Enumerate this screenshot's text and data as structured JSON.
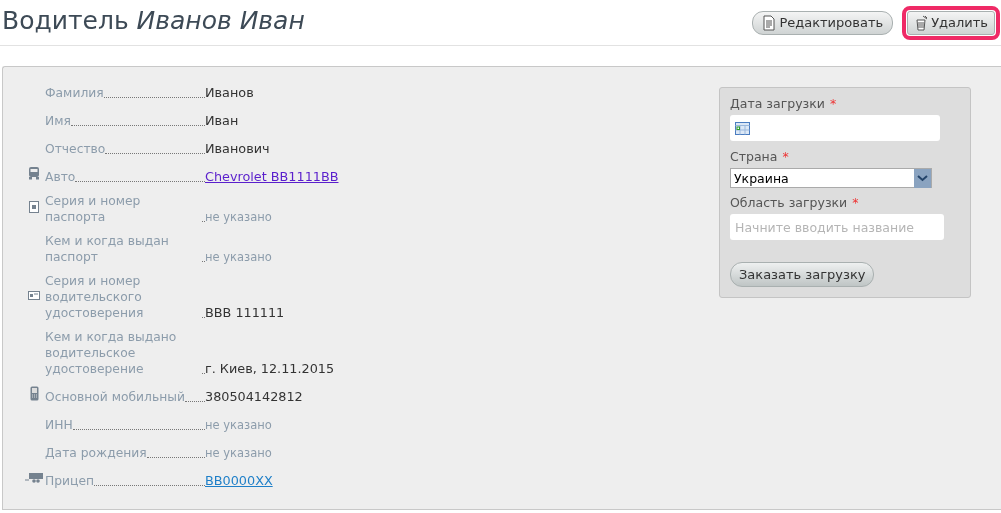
{
  "header": {
    "title": "Водитель *Иванов Иван*",
    "buttons": [
      {
        "label": "Редактировать",
        "highlighted": false
      },
      {
        "label": "Удалить",
        "highlighted": true
      }
    ]
  },
  "details": [
    {
      "label": "Фамилия",
      "value": "Иванов",
      "kind": "text"
    },
    {
      "label": "Имя",
      "value": "Иван",
      "kind": "text"
    },
    {
      "label": "Отчество",
      "value": "Иванович",
      "kind": "text"
    },
    {
      "label": "Авто",
      "value": "Chevrolet BB1111BB",
      "kind": "link",
      "visited": true
    },
    {
      "label": "Серия и номер паспорта",
      "value": "не указано",
      "kind": "missing"
    },
    {
      "label": "Кем и когда выдан паспорт",
      "value": "не указано",
      "kind": "missing"
    },
    {
      "label": "Серия и номер водительского удостоверения",
      "value": "BBB 111111",
      "kind": "text"
    },
    {
      "label": "Кем и когда выдано водительское удостоверение",
      "value": "г. Киев, 12.11.2015",
      "kind": "text"
    },
    {
      "label": "Основной мобильный",
      "value": "380504142812",
      "kind": "text"
    },
    {
      "label": "ИНН",
      "value": "не указано",
      "kind": "missing"
    },
    {
      "label": "Дата рождения",
      "value": "не указано",
      "kind": "missing"
    },
    {
      "label": "Прицеп",
      "value": "BB0000XX",
      "kind": "link",
      "visited": false
    }
  ],
  "order_form": {
    "fields": [
      {
        "kind": "date",
        "label": "Дата загрузки",
        "required_mark": "*"
      },
      {
        "kind": "select",
        "label": "Страна",
        "required_mark": "*",
        "value": "Украина"
      },
      {
        "kind": "text",
        "label": "Область загрузки",
        "required_mark": "*",
        "placeholder": "Начните вводить название"
      }
    ],
    "button": "Заказать загрузку"
  }
}
